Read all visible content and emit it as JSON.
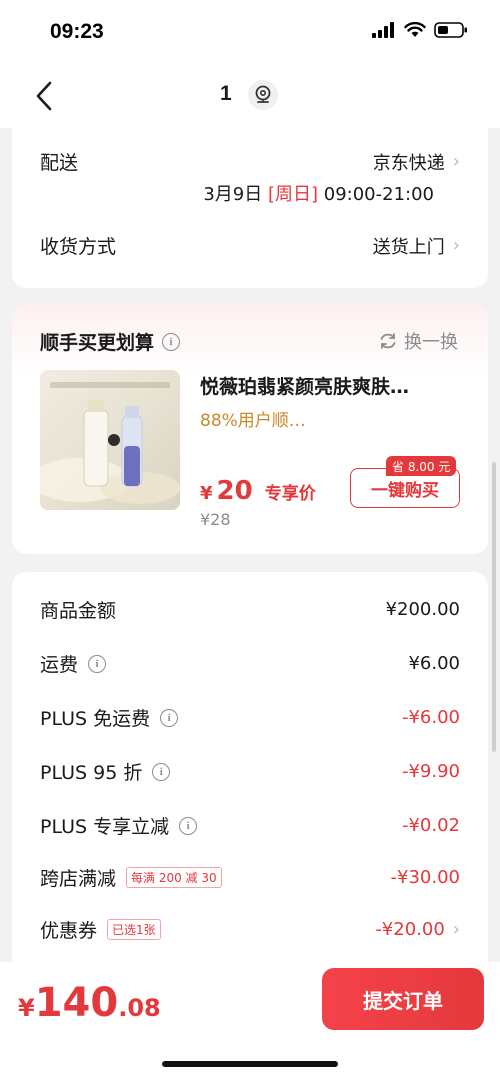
{
  "status": {
    "time": "09:23"
  },
  "nav": {
    "title": "1",
    "back_icon": "chevron-left-icon",
    "location_icon": "location-pin-icon"
  },
  "delivery": {
    "label": "配送",
    "carrier": "京东快递",
    "date": "3月9日",
    "weekday": "[周日]",
    "window": "09:00-21:00",
    "receive_label": "收货方式",
    "receive_value": "送货上门"
  },
  "addon": {
    "title": "顺手买更划算",
    "refresh_label": "换一换",
    "product_name": "悦薇珀翡紧颜亮肤爽肤…",
    "rating_text": "88%用户顺…",
    "price_yen": "¥",
    "price": "20",
    "price_tag": "专享价",
    "original_price": "¥28",
    "buy_label": "一键购买",
    "save_badge": "省 8.00 元"
  },
  "summary": {
    "rows": [
      {
        "label": "商品金额",
        "value": "¥200.00",
        "color": "#1a1a1a"
      },
      {
        "label": "运费",
        "value": "¥6.00",
        "color": "#1a1a1a"
      },
      {
        "label": "PLUS 免运费",
        "value": "-¥6.00",
        "color": "#e4393c"
      },
      {
        "label": "PLUS 95 折",
        "value": "-¥9.90",
        "color": "#e4393c"
      },
      {
        "label": "PLUS 专享立减",
        "value": "-¥0.02",
        "color": "#e4393c"
      },
      {
        "label": "跨店满减",
        "tag": "每满 200 减 30",
        "value": "-¥30.00",
        "color": "#e4393c"
      },
      {
        "label": "优惠券",
        "tag": "已选1张",
        "value": "-¥20.00",
        "color": "#e4393c"
      }
    ]
  },
  "footer": {
    "total_yen": "¥",
    "total_int": "140",
    "total_dec": ".08",
    "submit_label": "提交订单"
  },
  "colors": {
    "accent": "#e4393c",
    "gold": "#c9882b"
  }
}
